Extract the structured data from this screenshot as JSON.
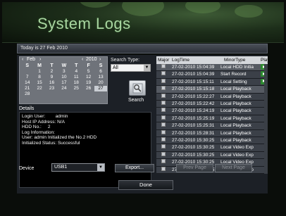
{
  "header": {
    "title": "System Logs"
  },
  "today_text": "Today is 27 Feb 2010",
  "calendar": {
    "month": "Feb",
    "year": "2010",
    "weekdays": [
      "S",
      "M",
      "T",
      "W",
      "T",
      "F",
      "S"
    ],
    "weeks": [
      [
        "",
        "1",
        "2",
        "3",
        "4",
        "5",
        "6"
      ],
      [
        "7",
        "8",
        "9",
        "10",
        "11",
        "12",
        "13"
      ],
      [
        "14",
        "15",
        "16",
        "17",
        "18",
        "19",
        "20"
      ],
      [
        "21",
        "22",
        "23",
        "24",
        "25",
        "26",
        "27"
      ],
      [
        "28",
        "",
        "",
        "",
        "",
        "",
        ""
      ]
    ],
    "selected_day": "27"
  },
  "search": {
    "type_label": "Search Type:",
    "type_value": "All",
    "button_label": "Search"
  },
  "details": {
    "label": "Details",
    "lines": [
      "Login User:        admin",
      "Host IP Address: N/A",
      "HDD No.:     2",
      "",
      "Log Information:",
      "User: admin Initialized the No.2 HDD",
      "Initialized Status: Successful"
    ]
  },
  "log_table": {
    "columns": [
      "Major",
      "LogTime",
      "MinorType",
      "Play"
    ],
    "rows": [
      {
        "time": "27-02-2010 15:04:39",
        "type": "Local HDD Initia",
        "play": true,
        "style": "plain"
      },
      {
        "time": "27-02-2010 15:04:39",
        "type": "Start Record",
        "play": true,
        "style": "alt"
      },
      {
        "time": "27-02-2010 15:15:11",
        "type": "Local Setting",
        "play": true,
        "style": "alt"
      },
      {
        "time": "27-02-2010 15:15:18",
        "type": "Local Playback",
        "play": false,
        "style": "plain"
      },
      {
        "time": "27-02-2010 15:22:27",
        "type": "Local Playback",
        "play": false,
        "style": "alt"
      },
      {
        "time": "27-02-2010 15:22:42",
        "type": "Local Playback",
        "play": false,
        "style": "alt"
      },
      {
        "time": "27-02-2010 15:24:19",
        "type": "Local Playback",
        "play": false,
        "style": "alt"
      },
      {
        "time": "27-02-2010 15:25:19",
        "type": "Local Playback",
        "play": false,
        "style": "alt"
      },
      {
        "time": "27-02-2010 15:25:31",
        "type": "Local Playback",
        "play": false,
        "style": "alt"
      },
      {
        "time": "27-02-2010 15:28:31",
        "type": "Local Playback",
        "play": false,
        "style": "alt"
      },
      {
        "time": "27-02-2010 15:30:25",
        "type": "Local Playback",
        "play": false,
        "style": "alt"
      },
      {
        "time": "27-02-2010 15:30:25",
        "type": "Local Video Exp",
        "play": false,
        "style": "alt"
      },
      {
        "time": "27-02-2010 15:30:25",
        "type": "Local Video Exp",
        "play": false,
        "style": "alt"
      },
      {
        "time": "27-02-2010 15:30:25",
        "type": "Local Video Exp",
        "play": false,
        "style": "alt"
      },
      {
        "time": "27-02-2010 15:30:25",
        "type": "Local Video Exp",
        "play": false,
        "style": "alt"
      }
    ]
  },
  "footer": {
    "device_label": "Device",
    "device_value": "USB1",
    "export_label": "Export...",
    "prev_label": "Prev Page",
    "next_label": "Next Page",
    "done_label": "Done"
  },
  "colors": {
    "play_green": "#2d8a2f",
    "title_green": "#a8d6a0",
    "row_highlight": "#555a62"
  },
  "icons": {
    "search": "magnifier-icon",
    "play": "play-icon",
    "record": "log-entry-icon"
  }
}
